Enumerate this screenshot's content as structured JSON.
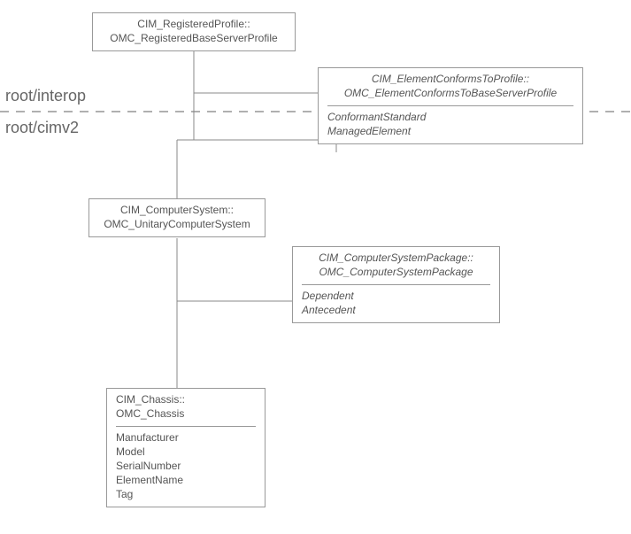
{
  "namespaces": {
    "top": "root/interop",
    "bottom": "root/cimv2"
  },
  "boxes": {
    "registeredProfile": {
      "line1": "CIM_RegisteredProfile::",
      "line2": "OMC_RegisteredBaseServerProfile"
    },
    "elementConforms": {
      "line1": "CIM_ElementConformsToProfile::",
      "line2": "OMC_ElementConformsToBaseServerProfile",
      "attrs": [
        "ConformantStandard",
        "ManagedElement"
      ]
    },
    "computerSystem": {
      "line1": "CIM_ComputerSystem::",
      "line2": "OMC_UnitaryComputerSystem"
    },
    "computerSystemPackage": {
      "line1": "CIM_ComputerSystemPackage::",
      "line2": "OMC_ComputerSystemPackage",
      "attrs": [
        "Dependent",
        "Antecedent"
      ]
    },
    "chassis": {
      "line1": "CIM_Chassis::",
      "line2": "OMC_Chassis",
      "attrs": [
        "Manufacturer",
        "Model",
        "SerialNumber",
        "ElementName",
        "Tag"
      ]
    }
  }
}
